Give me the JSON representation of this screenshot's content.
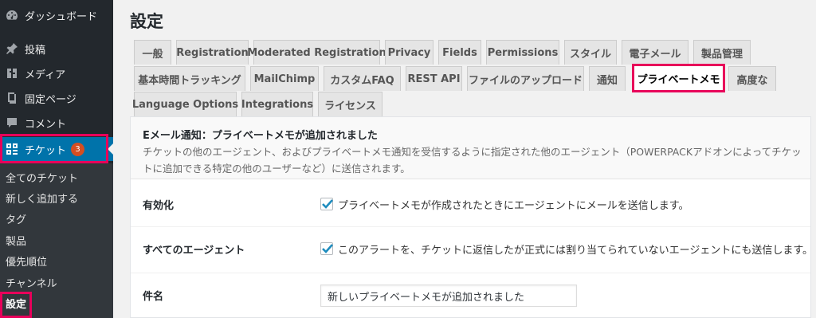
{
  "sidebar": {
    "menu": [
      {
        "label": "ダッシュボード",
        "icon": "dashboard-icon"
      },
      {
        "label": "投稿",
        "icon": "pin-icon"
      },
      {
        "label": "メディア",
        "icon": "media-icon"
      },
      {
        "label": "固定ページ",
        "icon": "page-icon"
      },
      {
        "label": "コメント",
        "icon": "comment-icon"
      },
      {
        "label": "チケット",
        "icon": "tickets-grid-icon",
        "badge": "3"
      }
    ],
    "submenu": [
      "全てのチケット",
      "新しく追加する",
      "タグ",
      "製品",
      "優先順位",
      "チャンネル",
      "設定"
    ],
    "accent_color": "#0073aa",
    "highlight_color": "#e8005a"
  },
  "page": {
    "title": "設定"
  },
  "tabs": {
    "row1": [
      "一般",
      "Registration",
      "Moderated Registration",
      "Privacy",
      "Fields",
      "Permissions",
      "スタイル",
      "電子メール",
      "製品管理"
    ],
    "row2": [
      "基本時間トラッキング",
      "MailChimp",
      "カスタムFAQ",
      "REST API",
      "ファイルのアップロード",
      "通知",
      "プライベートメモ",
      "高度な"
    ],
    "row3": [
      "Language Options",
      "Integrations",
      "ライセンス"
    ],
    "active": "プライベートメモ"
  },
  "section": {
    "title": "Eメール通知：プライベートメモが追加されました",
    "description": "チケットの他のエージェント、およびプライベートメモ通知を受信するように指定された他のエージェント（POWERPACKアドオンによってチケットに追加できる特定の他のユーザーなど）に送信されます。"
  },
  "fields": {
    "enabled": {
      "label": "有効化",
      "checked": true,
      "text": "プライベートメモが作成されたときにエージェントにメールを送信します。"
    },
    "all_agents": {
      "label": "すべてのエージェント",
      "checked": true,
      "text": "このアラートを、チケットに返信したが正式には割り当てられていないエージェントにも送信します。"
    },
    "subject": {
      "label": "件名",
      "value": "新しいプライベートメモが追加されました"
    }
  }
}
